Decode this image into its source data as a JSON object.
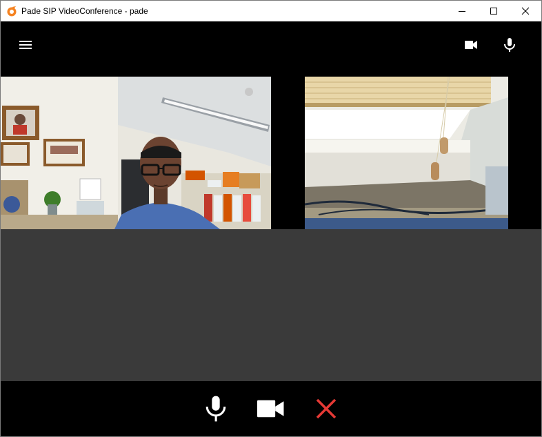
{
  "window": {
    "title": "Pade SIP VideoConference - pade",
    "controls": [
      "minimize",
      "maximize",
      "close"
    ]
  },
  "topbar": {
    "icons": [
      "menu-icon",
      "video-camera-icon",
      "microphone-icon"
    ]
  },
  "videos": [
    {
      "label": "local-participant-video",
      "content": "person-in-office"
    },
    {
      "label": "remote-participant-video",
      "content": "window-blinds"
    }
  ],
  "controls": {
    "icons": [
      "microphone-icon",
      "video-camera-icon",
      "hangup-x-icon"
    ],
    "colors": {
      "hangup": "#e53935",
      "icons": "#ffffff"
    }
  }
}
